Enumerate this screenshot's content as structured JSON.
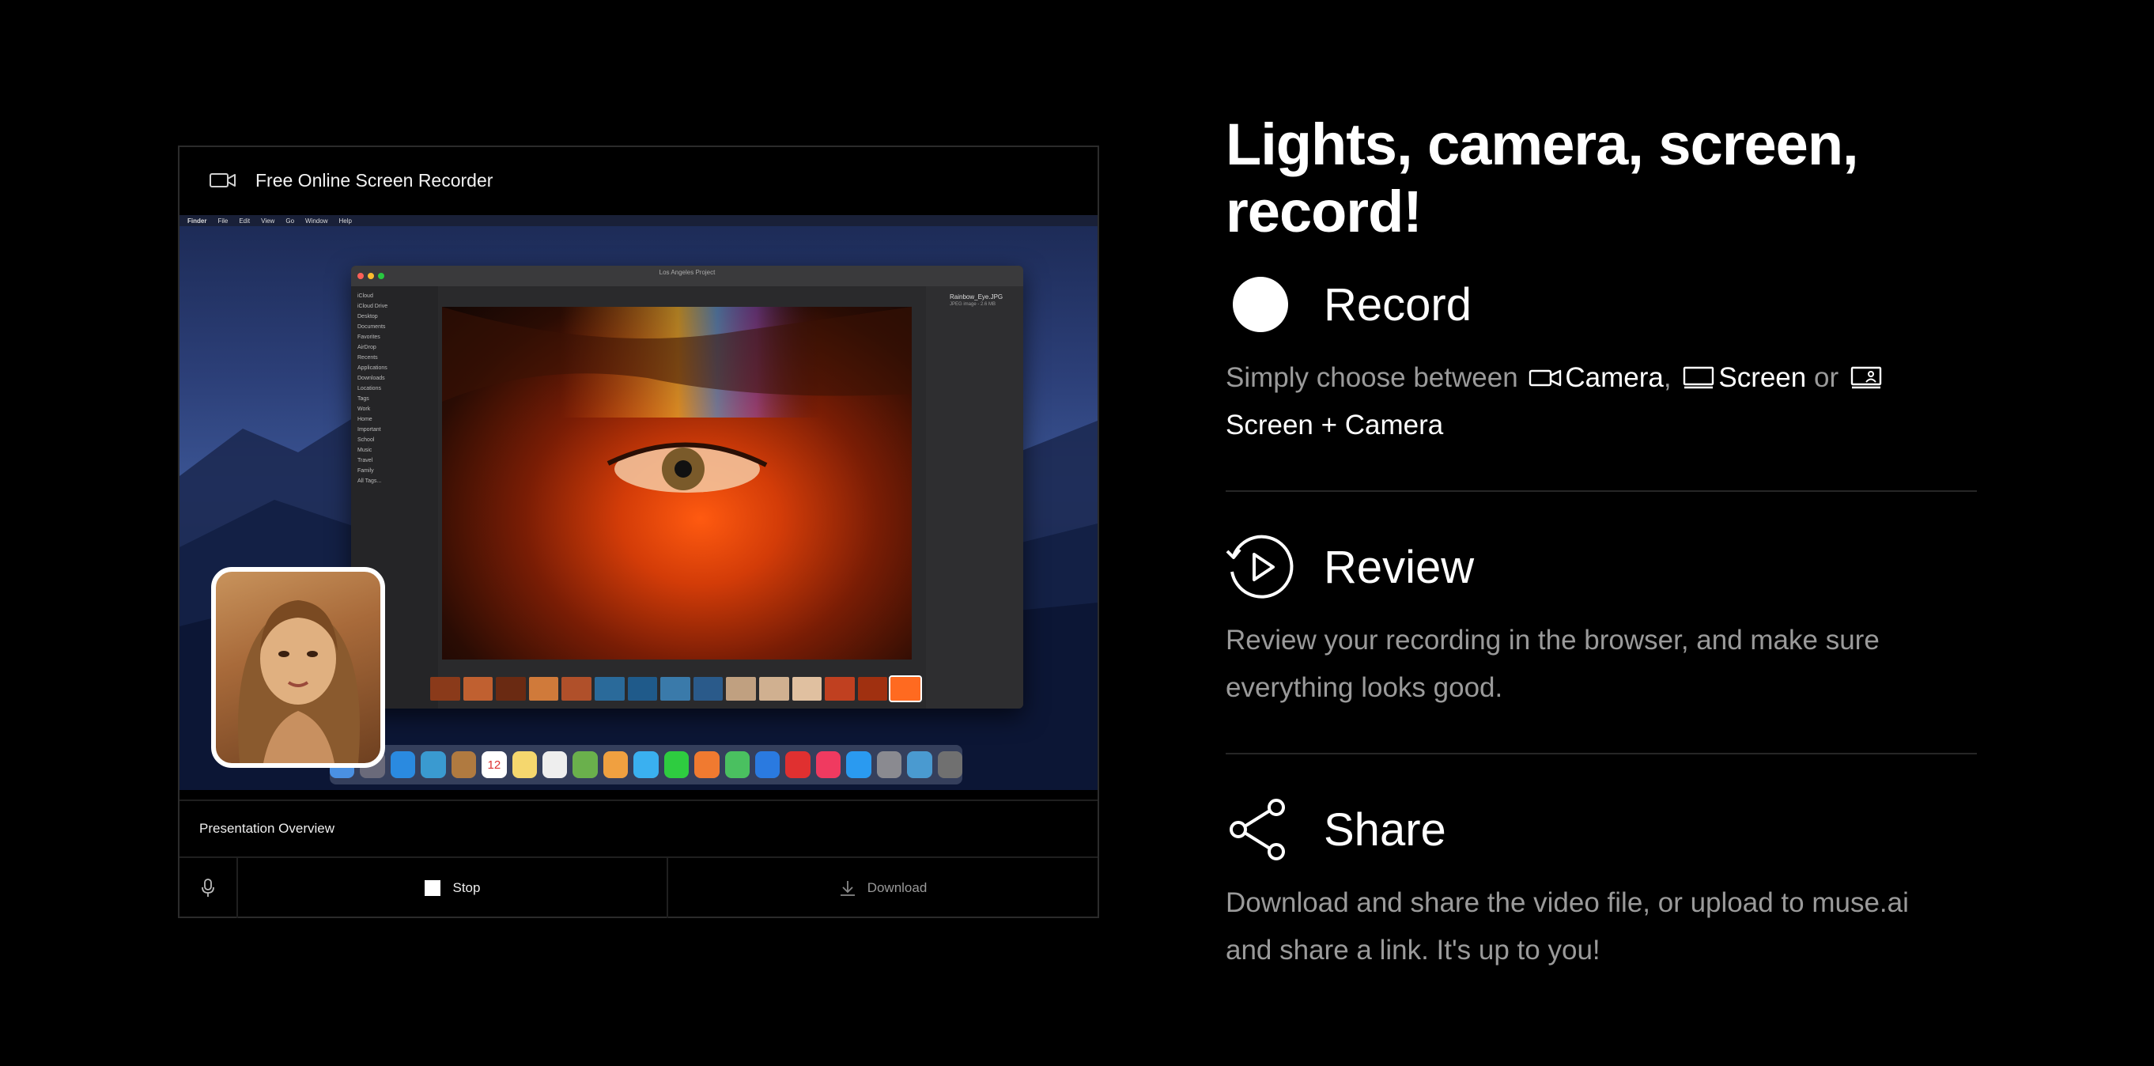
{
  "recorder": {
    "title": "Free Online Screen Recorder",
    "presentation_title": "Presentation Overview",
    "stop_label": "Stop",
    "download_label": "Download",
    "screen": {
      "menubar": [
        "Finder",
        "File",
        "Edit",
        "View",
        "Go",
        "Window",
        "Help"
      ],
      "finder_title": "Los Angeles Project",
      "finder_sidebar": [
        "iCloud",
        "iCloud Drive",
        "Desktop",
        "Documents",
        "Favorites",
        "AirDrop",
        "Recents",
        "Applications",
        "Downloads",
        "Locations",
        "Tags",
        "Work",
        "Home",
        "Important",
        "School",
        "Music",
        "Travel",
        "Family",
        "All Tags..."
      ],
      "file_name": "Rainbow_Eye.JPG",
      "file_meta": "JPEG image - 2.6 MB",
      "dock_date": "12"
    }
  },
  "right": {
    "headline": "Lights, camera, screen, record!",
    "record": {
      "title": "Record",
      "text_prefix": "Simply choose between",
      "camera": "Camera",
      "comma": ",",
      "screen": "Screen",
      "or": "or",
      "screen_camera": "Screen + Camera"
    },
    "review": {
      "title": "Review",
      "text": "Review your recording in the browser, and make sure everything looks good."
    },
    "share": {
      "title": "Share",
      "text": "Download and share the video file, or upload to muse.ai and share a link. It's up to you!"
    }
  },
  "colors": {
    "background": "#000000",
    "text": "#ffffff",
    "muted_text": "#9a9a9a",
    "divider": "#262626"
  },
  "icons": [
    "video-camera-icon",
    "microphone-icon",
    "stop-icon",
    "download-icon",
    "record-dot-icon",
    "review-replay-icon",
    "share-icon",
    "camera-icon",
    "screen-icon",
    "screen-camera-icon"
  ]
}
